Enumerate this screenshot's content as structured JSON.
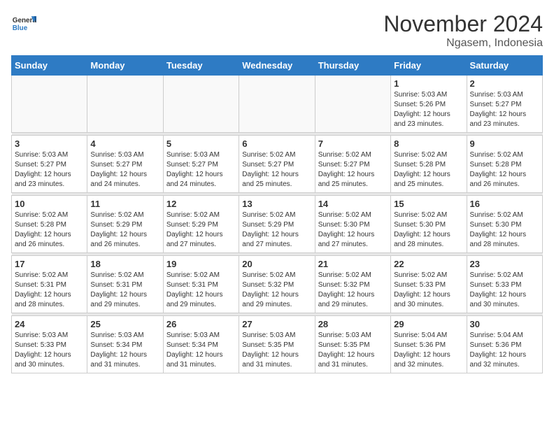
{
  "header": {
    "logo_general": "General",
    "logo_blue": "Blue",
    "month_title": "November 2024",
    "location": "Ngasem, Indonesia"
  },
  "weekdays": [
    "Sunday",
    "Monday",
    "Tuesday",
    "Wednesday",
    "Thursday",
    "Friday",
    "Saturday"
  ],
  "weeks": [
    [
      {
        "day": "",
        "info": ""
      },
      {
        "day": "",
        "info": ""
      },
      {
        "day": "",
        "info": ""
      },
      {
        "day": "",
        "info": ""
      },
      {
        "day": "",
        "info": ""
      },
      {
        "day": "1",
        "info": "Sunrise: 5:03 AM\nSunset: 5:26 PM\nDaylight: 12 hours\nand 23 minutes."
      },
      {
        "day": "2",
        "info": "Sunrise: 5:03 AM\nSunset: 5:27 PM\nDaylight: 12 hours\nand 23 minutes."
      }
    ],
    [
      {
        "day": "3",
        "info": "Sunrise: 5:03 AM\nSunset: 5:27 PM\nDaylight: 12 hours\nand 23 minutes."
      },
      {
        "day": "4",
        "info": "Sunrise: 5:03 AM\nSunset: 5:27 PM\nDaylight: 12 hours\nand 24 minutes."
      },
      {
        "day": "5",
        "info": "Sunrise: 5:03 AM\nSunset: 5:27 PM\nDaylight: 12 hours\nand 24 minutes."
      },
      {
        "day": "6",
        "info": "Sunrise: 5:02 AM\nSunset: 5:27 PM\nDaylight: 12 hours\nand 25 minutes."
      },
      {
        "day": "7",
        "info": "Sunrise: 5:02 AM\nSunset: 5:27 PM\nDaylight: 12 hours\nand 25 minutes."
      },
      {
        "day": "8",
        "info": "Sunrise: 5:02 AM\nSunset: 5:28 PM\nDaylight: 12 hours\nand 25 minutes."
      },
      {
        "day": "9",
        "info": "Sunrise: 5:02 AM\nSunset: 5:28 PM\nDaylight: 12 hours\nand 26 minutes."
      }
    ],
    [
      {
        "day": "10",
        "info": "Sunrise: 5:02 AM\nSunset: 5:28 PM\nDaylight: 12 hours\nand 26 minutes."
      },
      {
        "day": "11",
        "info": "Sunrise: 5:02 AM\nSunset: 5:29 PM\nDaylight: 12 hours\nand 26 minutes."
      },
      {
        "day": "12",
        "info": "Sunrise: 5:02 AM\nSunset: 5:29 PM\nDaylight: 12 hours\nand 27 minutes."
      },
      {
        "day": "13",
        "info": "Sunrise: 5:02 AM\nSunset: 5:29 PM\nDaylight: 12 hours\nand 27 minutes."
      },
      {
        "day": "14",
        "info": "Sunrise: 5:02 AM\nSunset: 5:30 PM\nDaylight: 12 hours\nand 27 minutes."
      },
      {
        "day": "15",
        "info": "Sunrise: 5:02 AM\nSunset: 5:30 PM\nDaylight: 12 hours\nand 28 minutes."
      },
      {
        "day": "16",
        "info": "Sunrise: 5:02 AM\nSunset: 5:30 PM\nDaylight: 12 hours\nand 28 minutes."
      }
    ],
    [
      {
        "day": "17",
        "info": "Sunrise: 5:02 AM\nSunset: 5:31 PM\nDaylight: 12 hours\nand 28 minutes."
      },
      {
        "day": "18",
        "info": "Sunrise: 5:02 AM\nSunset: 5:31 PM\nDaylight: 12 hours\nand 29 minutes."
      },
      {
        "day": "19",
        "info": "Sunrise: 5:02 AM\nSunset: 5:31 PM\nDaylight: 12 hours\nand 29 minutes."
      },
      {
        "day": "20",
        "info": "Sunrise: 5:02 AM\nSunset: 5:32 PM\nDaylight: 12 hours\nand 29 minutes."
      },
      {
        "day": "21",
        "info": "Sunrise: 5:02 AM\nSunset: 5:32 PM\nDaylight: 12 hours\nand 29 minutes."
      },
      {
        "day": "22",
        "info": "Sunrise: 5:02 AM\nSunset: 5:33 PM\nDaylight: 12 hours\nand 30 minutes."
      },
      {
        "day": "23",
        "info": "Sunrise: 5:02 AM\nSunset: 5:33 PM\nDaylight: 12 hours\nand 30 minutes."
      }
    ],
    [
      {
        "day": "24",
        "info": "Sunrise: 5:03 AM\nSunset: 5:33 PM\nDaylight: 12 hours\nand 30 minutes."
      },
      {
        "day": "25",
        "info": "Sunrise: 5:03 AM\nSunset: 5:34 PM\nDaylight: 12 hours\nand 31 minutes."
      },
      {
        "day": "26",
        "info": "Sunrise: 5:03 AM\nSunset: 5:34 PM\nDaylight: 12 hours\nand 31 minutes."
      },
      {
        "day": "27",
        "info": "Sunrise: 5:03 AM\nSunset: 5:35 PM\nDaylight: 12 hours\nand 31 minutes."
      },
      {
        "day": "28",
        "info": "Sunrise: 5:03 AM\nSunset: 5:35 PM\nDaylight: 12 hours\nand 31 minutes."
      },
      {
        "day": "29",
        "info": "Sunrise: 5:04 AM\nSunset: 5:36 PM\nDaylight: 12 hours\nand 32 minutes."
      },
      {
        "day": "30",
        "info": "Sunrise: 5:04 AM\nSunset: 5:36 PM\nDaylight: 12 hours\nand 32 minutes."
      }
    ]
  ]
}
